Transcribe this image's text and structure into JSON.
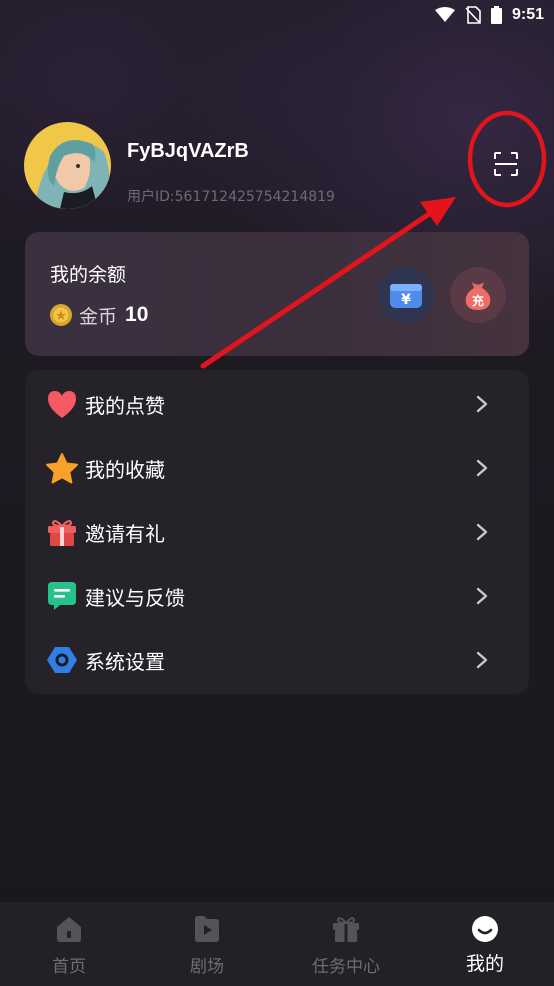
{
  "status_bar": {
    "time": "9:51",
    "icons": [
      "wifi-icon",
      "no-sim-icon",
      "battery-icon"
    ]
  },
  "profile": {
    "username": "FyBJqVAZrB",
    "user_id": "用户ID:561712425754214819",
    "avatar": "avatar-image",
    "scan_icon": "scan-icon"
  },
  "balance": {
    "title": "我的余额",
    "coin_label": "金币",
    "coin_value": "10",
    "wallet_glyph": "¥",
    "recharge_glyph": "充"
  },
  "menu": {
    "items": [
      {
        "label": "我的点赞",
        "icon": "heart-icon"
      },
      {
        "label": "我的收藏",
        "icon": "star-icon"
      },
      {
        "label": "邀请有礼",
        "icon": "gift-icon"
      },
      {
        "label": "建议与反馈",
        "icon": "feedback-icon"
      },
      {
        "label": "系统设置",
        "icon": "settings-icon"
      }
    ]
  },
  "bottom_nav": {
    "items": [
      {
        "label": "首页",
        "icon": "home-icon"
      },
      {
        "label": "剧场",
        "icon": "theater-icon"
      },
      {
        "label": "任务中心",
        "icon": "task-gift-icon"
      },
      {
        "label": "我的",
        "icon": "profile-icon",
        "active": true
      }
    ]
  },
  "colors": {
    "annotation": "#e3141b",
    "background": "#1d1a22",
    "card": "#252329",
    "inactive_text": "#6f6c75"
  }
}
